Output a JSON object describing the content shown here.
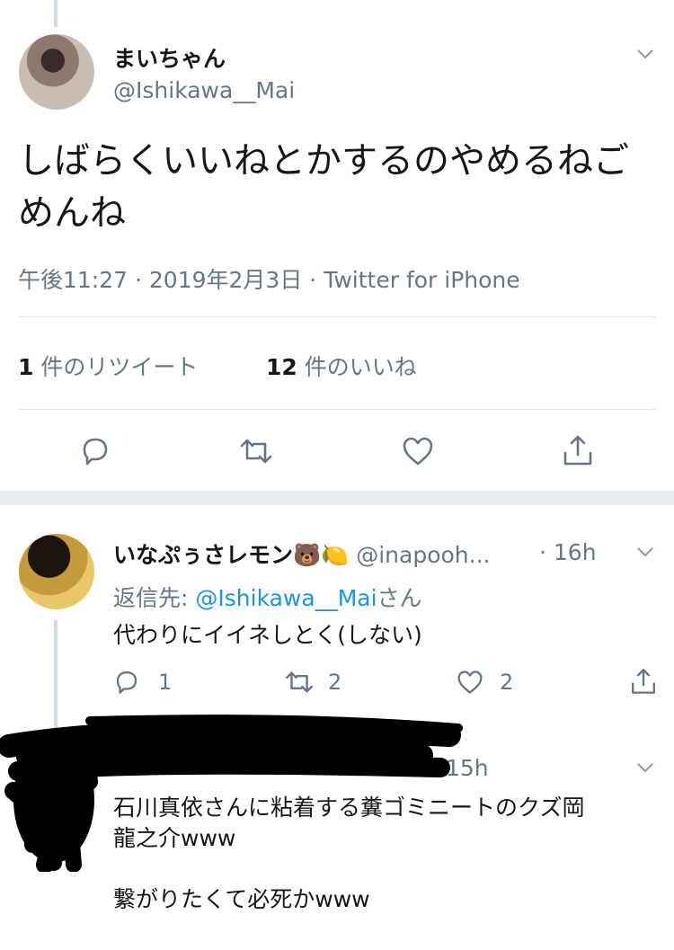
{
  "main_tweet": {
    "display_name": "まいちゃん",
    "handle": "@Ishikawa__Mai",
    "text_line1": "しばらくいいねとかするのやめるねご",
    "text_line2": "めんね",
    "time": "午後11:27",
    "date": "2019年2月3日",
    "source": "Twitter for iPhone",
    "separator": "·",
    "retweet_count": "1",
    "retweet_label": "件のリツイート",
    "like_count": "12",
    "like_label": "件のいいね"
  },
  "reply1": {
    "display_name": "いなぷぅさレモン🐻🍋",
    "handle": "@inapooh...",
    "separator": "·",
    "time": "16h",
    "reply_to_prefix": "返信先:",
    "reply_to_handle": "@Ishikawa__Mai",
    "reply_to_suffix": "さん",
    "text": "代わりにイイネしとく(しない)",
    "reply_count": "1",
    "retweet_count": "2",
    "like_count": "2"
  },
  "reply2": {
    "time": "15h",
    "text_line1": "石川真依さんに粘着する糞ゴミニートのクズ岡",
    "text_line2": "龍之介www",
    "text_line3": "繋がりたくて必死かwww"
  },
  "colors": {
    "link": "#1b95e0",
    "secondary": "#657786",
    "primary": "#14171a"
  }
}
